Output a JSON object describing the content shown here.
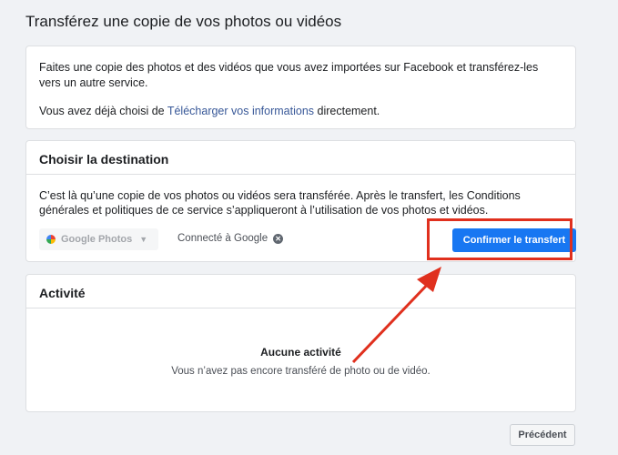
{
  "page": {
    "title": "Transférez une copie de vos photos ou vidéos"
  },
  "intro": {
    "line1": "Faites une copie des photos et des vidéos que vous avez importées sur Facebook et transférez-les vers un autre service.",
    "line2_prefix": "Vous avez déjà choisi de ",
    "line2_link": "Télécharger vos informations",
    "line2_suffix": " directement."
  },
  "destination": {
    "header": "Choisir la destination",
    "description": "C’est là qu’une copie de vos photos ou vidéos sera transférée. Après le transfert, les Conditions générales et politiques de ce service s’appliqueront à l’utilisation de vos photos et vidéos.",
    "selected_service": "Google Photos",
    "connected_label": "Connecté à Google",
    "confirm_label": "Confirmer le transfert"
  },
  "activity": {
    "header": "Activité",
    "empty_title": "Aucune activité",
    "empty_subtitle": "Vous n’avez pas encore transféré de photo ou de vidéo."
  },
  "footer": {
    "previous_label": "Précédent"
  },
  "colors": {
    "primary": "#1877f2",
    "annotation": "#e0301e",
    "link": "#385898",
    "background": "#f0f2f5"
  }
}
